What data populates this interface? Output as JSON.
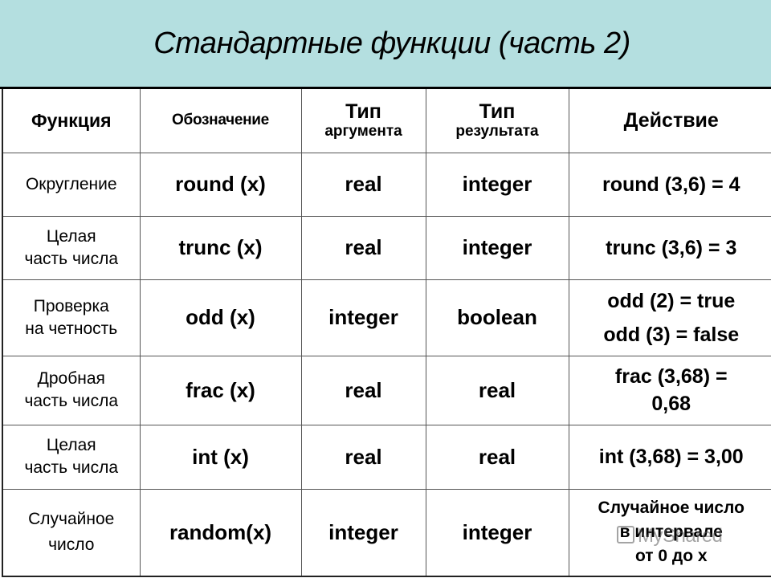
{
  "title": "Стандартные функции (часть 2)",
  "table": {
    "headers": {
      "function": "Функция",
      "notation": "Обозначение",
      "arg_type_main": "Тип",
      "arg_type_sub": "аргумента",
      "result_type_main": "Тип",
      "result_type_sub": "результата",
      "action": "Действие"
    },
    "rows": [
      {
        "name": [
          "Округление"
        ],
        "notation": "round (x)",
        "arg_type": "real",
        "result_type": "integer",
        "action": [
          "round (3,6) = 4"
        ]
      },
      {
        "name": [
          "Целая",
          "часть числа"
        ],
        "notation": "trunc (x)",
        "arg_type": "real",
        "result_type": "integer",
        "action": [
          "trunc (3,6) = 3"
        ]
      },
      {
        "name": [
          "Проверка",
          "на четность"
        ],
        "notation": "odd (x)",
        "arg_type": "integer",
        "result_type": "boolean",
        "action": [
          "odd (2) = true",
          "odd (3) = false"
        ]
      },
      {
        "name": [
          "Дробная",
          "часть числа"
        ],
        "notation": "frac (x)",
        "arg_type": "real",
        "result_type": "real",
        "action": [
          "frac (3,68) =",
          "0,68"
        ]
      },
      {
        "name": [
          "Целая",
          "часть числа"
        ],
        "notation": "int (x)",
        "arg_type": "real",
        "result_type": "real",
        "action": [
          "int (3,68) = 3,00"
        ]
      },
      {
        "name": [
          "Случайное",
          "число"
        ],
        "notation": "random(x)",
        "arg_type": "integer",
        "result_type": "integer",
        "action": [
          "Случайное число",
          "в интервале",
          "от 0 до х"
        ]
      }
    ]
  },
  "watermark": {
    "icon": "myshared-logo-icon",
    "text": "MyShared"
  }
}
